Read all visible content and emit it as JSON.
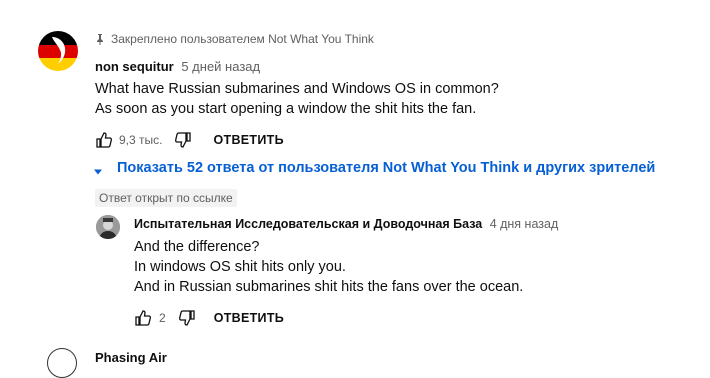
{
  "pinned": {
    "icon": "pin-icon",
    "text": "Закреплено пользователем Not What You Think"
  },
  "comment": {
    "author": "non sequitur",
    "time": "5 дней назад",
    "lines": [
      "What have Russian submarines and Windows OS in common?",
      "As soon as you start opening a window the shit hits the fan."
    ],
    "likes": "9,3 тыс.",
    "reply_label": "ОТВЕТИТЬ"
  },
  "show_replies": {
    "icon": "chevron-down-icon",
    "label": "Показать 52 ответа от пользователя Not What You Think и других зрителей"
  },
  "linked_badge": "Ответ открыт по ссылке",
  "reply": {
    "author": "Испытательная Исследовательская и Доводочная База",
    "time": "4 дня назад",
    "lines": [
      "And the difference?",
      "In windows OS  shit hits only you.",
      "And in Russian submarines shit hits the fans over the ocean."
    ],
    "likes": "2",
    "reply_label": "ОТВЕТИТЬ"
  },
  "next_comment": {
    "author_partial": "Phasing Air"
  },
  "colors": {
    "link_blue": "#065fd4",
    "muted": "#606060",
    "text": "#0f0f0f",
    "badge_bg": "#f2f2f2"
  }
}
